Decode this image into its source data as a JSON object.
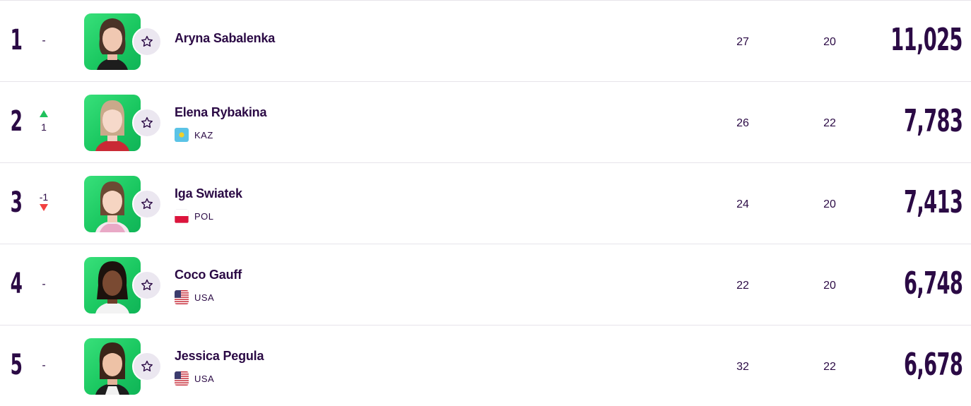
{
  "rows": [
    {
      "rank": "1",
      "movement": "-",
      "direction": "none",
      "name": "Aryna Sabalenka",
      "country": "",
      "flag": "",
      "tournaments": "27",
      "counted": "20",
      "points": "11,025"
    },
    {
      "rank": "2",
      "movement": "1",
      "direction": "up",
      "name": "Elena Rybakina",
      "country": "KAZ",
      "flag": "kaz-flag-icon",
      "tournaments": "26",
      "counted": "22",
      "points": "7,783"
    },
    {
      "rank": "3",
      "movement": "-1",
      "direction": "down",
      "name": "Iga Swiatek",
      "country": "POL",
      "flag": "pol-flag-icon",
      "tournaments": "24",
      "counted": "20",
      "points": "7,413"
    },
    {
      "rank": "4",
      "movement": "-",
      "direction": "none",
      "name": "Coco Gauff",
      "country": "USA",
      "flag": "usa-flag-icon",
      "tournaments": "22",
      "counted": "20",
      "points": "6,748"
    },
    {
      "rank": "5",
      "movement": "-",
      "direction": "none",
      "name": "Jessica Pegula",
      "country": "USA",
      "flag": "usa-flag-icon",
      "tournaments": "32",
      "counted": "22",
      "points": "6,678"
    }
  ],
  "colors": {
    "text": "#2b0a45",
    "up": "#1fc15c",
    "down": "#f24141",
    "photo_bg": "#1bc861",
    "fav_bg": "#ebe7f0"
  },
  "icons": {
    "favorite": "star-outline-icon",
    "up": "triangle-up-icon",
    "down": "triangle-down-icon"
  }
}
